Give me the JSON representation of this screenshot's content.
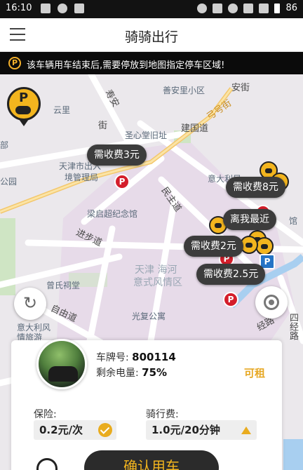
{
  "status_bar": {
    "time": "16:10",
    "battery": "86"
  },
  "header": {
    "title": "骑骑出行"
  },
  "notice": {
    "icon_text": "P",
    "text": "该车辆用车结束后,需要停放到地图指定停车区域!"
  },
  "map": {
    "labels": {
      "shanghui": "善安里小区",
      "anjie": "安街",
      "yungpartial": "云里",
      "shouan": "寿安",
      "street_jie": "街",
      "gongjie": "弓号街",
      "shengxin": "圣心堂旧址",
      "jianguodao": "建国道",
      "tianjin_exit_1": "天津市出入",
      "tianjin_exit_2": "境管理局",
      "yidali_top": "意大利风",
      "park": "公园",
      "minzhudao": "民主道",
      "liangqichao": "梁启超纪念馆",
      "jinbudao": "进步道",
      "tianjin_haihe_1": "天津 海河",
      "tianjin_haihe_2": "意式风情区",
      "zengshi": "曾氏祠堂",
      "ziyoudao": "自由道",
      "guangfu": "光复公寓",
      "yidali_bottom_1": "意大利风",
      "yidali_bottom_2": "情旅游",
      "jingjie": "经路",
      "sijing": "四经路",
      "guan": "馆",
      "bu": "部"
    },
    "bubbles": {
      "fee_3": "需收费3元",
      "fee_8": "需收费8元",
      "nearest": "离我最近",
      "fee_2": "需收费2元",
      "fee_2_5": "需收费2.5元"
    },
    "pin_letter": "P"
  },
  "card": {
    "plate_label": "车牌号:",
    "plate_value": "800114",
    "battery_label": "剩余电量:",
    "battery_value": "75%",
    "rent_status": "可租",
    "insurance_label": "保险:",
    "insurance_value": "0.2元/次",
    "ride_fee_label": "骑行费:",
    "ride_fee_value": "1.0元/20分钟",
    "confirm_label": "确认用车"
  }
}
